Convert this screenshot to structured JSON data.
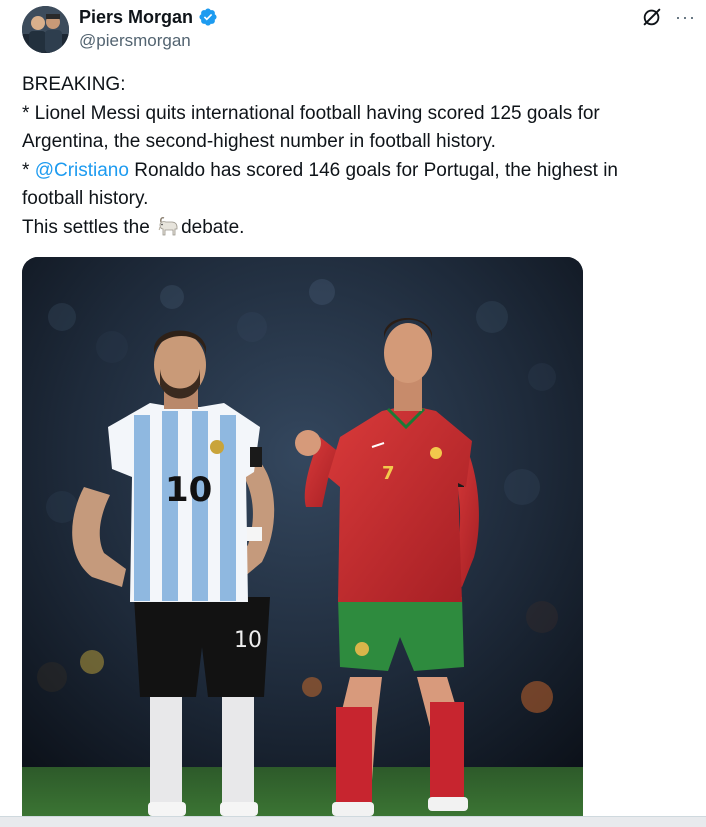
{
  "author": {
    "display_name": "Piers Morgan",
    "handle": "@piersmorgan",
    "verified": true,
    "avatar_icon": "avatar-photo"
  },
  "actions": {
    "grok_icon": "grok-icon",
    "more_icon": "more-options-icon",
    "more_glyph": "···"
  },
  "tweet": {
    "line1": "BREAKING:",
    "line2": "* Lionel Messi quits international football having scored 125 goals for",
    "line3": "Argentina, the second-highest number in football history.",
    "line4_prefix": "* ",
    "line4_mention": "@Cristiano",
    "line4_suffix": " Ronaldo has scored 146 goals for Portugal, the highest in",
    "line5": "football history.",
    "line6_before": "This settles the ",
    "line6_emoji": "goat-emoji",
    "line6_after": "debate."
  },
  "media": {
    "type": "photo",
    "left_player_number": "10",
    "right_player_number": "7",
    "left_shorts_number": "10"
  },
  "colors": {
    "text": "#0f1419",
    "secondary": "#536471",
    "link": "#1d9bf0",
    "verified": "#1d9bf0"
  }
}
